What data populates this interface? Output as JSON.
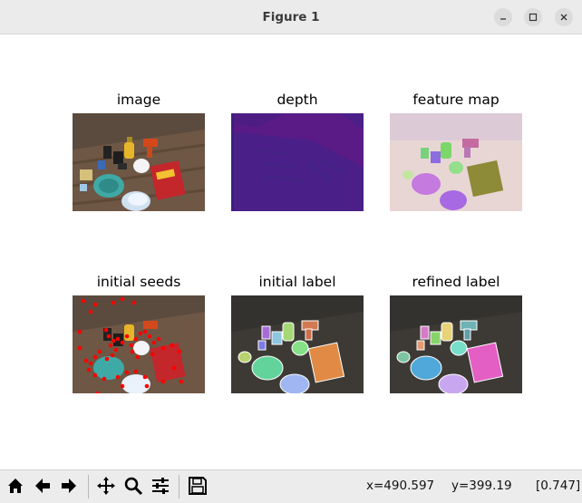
{
  "window": {
    "title": "Figure 1"
  },
  "panels": {
    "p1": {
      "title": "image"
    },
    "p2": {
      "title": "depth"
    },
    "p3": {
      "title": "feature map"
    },
    "p4": {
      "title": "initial seeds"
    },
    "p5": {
      "title": "initial label"
    },
    "p6": {
      "title": "refined label"
    }
  },
  "toolbar": {
    "icons": [
      "home-icon",
      "back-arrow-icon",
      "forward-arrow-icon",
      "pan-icon",
      "zoom-icon",
      "configure-subplots-icon",
      "save-icon"
    ]
  },
  "status": {
    "x": "x=490.597",
    "y": "y=399.19",
    "value": "[0.747]"
  },
  "colors": {
    "depth_background": "#4a1f88",
    "depth_band": "#5a1b86",
    "seed_color": "#ff0000"
  }
}
